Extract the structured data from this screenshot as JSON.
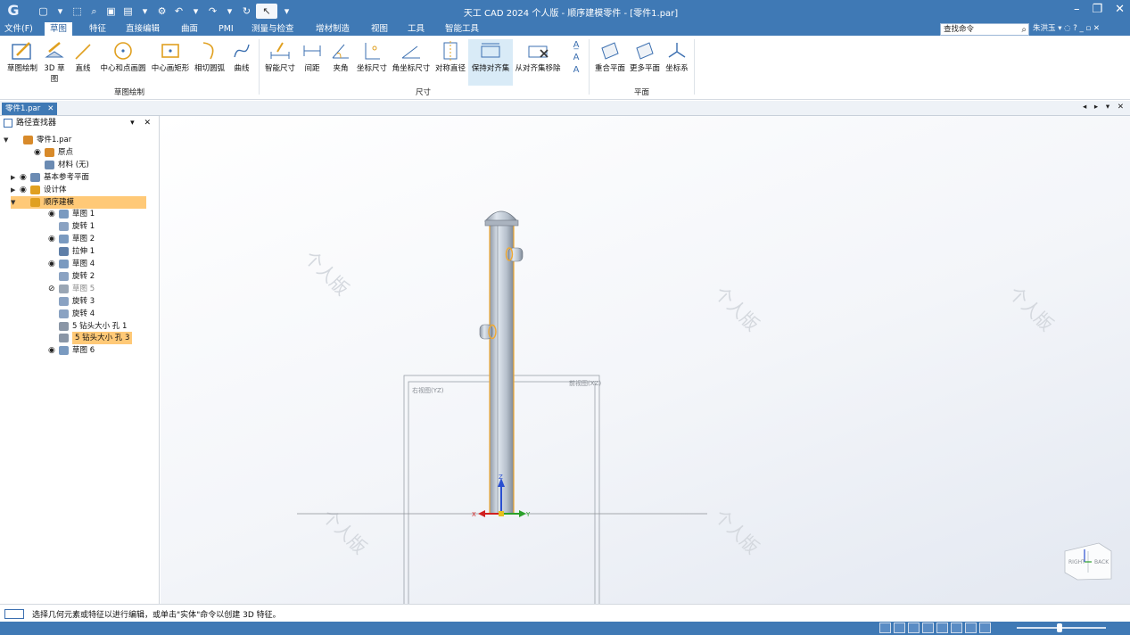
{
  "titlebar": {
    "title": "天工 CAD 2024 个人版 - 顺序建模零件 - [零件1.par]",
    "app_logo": "G",
    "qat_icons": [
      "new-file-icon",
      "open-file-icon",
      "save-icon",
      "save-as-icon",
      "settings-icon",
      "undo-icon",
      "redo-icon",
      "select-tool-icon"
    ],
    "controls": {
      "minimize": "–",
      "restore": "❐",
      "close": "✕"
    }
  },
  "menubar": {
    "items": [
      "文件(F)",
      "草图",
      "特征",
      "直接编辑",
      "曲面",
      "PMI",
      "测量与检查",
      "增材制造",
      "视图",
      "工具",
      "智能工具"
    ],
    "active_index": 1,
    "search_placeholder": "查找命令",
    "user": "朱洪玉",
    "help_icons": "▾ ◌ ?  _ ▫ ✕"
  },
  "ribbon": {
    "sketch_group": {
      "label": "草图绘制",
      "buttons": [
        "草图绘制",
        "3D 草图",
        "直线",
        "中心和点画圆",
        "中心画矩形",
        "相切圆弧",
        "曲线"
      ]
    },
    "dimension_group": {
      "label": "尺寸",
      "buttons": [
        "智能尺寸",
        "间距",
        "夹角",
        "坐标尺寸",
        "角坐标尺寸",
        "对称直径",
        "保持对齐集",
        "从对齐集移除"
      ]
    },
    "plane_group": {
      "label": "平面",
      "buttons": [
        "重合平面",
        "更多平面",
        "坐标系"
      ]
    }
  },
  "tabstrip": {
    "doc_tab": "零件1.par",
    "close": "✕",
    "nav": "◂ ▸ ▾ ✕"
  },
  "pathfinder": {
    "title": "路径查找器",
    "controls": "▾ ✕",
    "rows": [
      {
        "label": "零件1.par",
        "level": 0,
        "arrow": "▼",
        "eye": false
      },
      {
        "label": "原点",
        "level": 2,
        "arrow": "",
        "eye": true
      },
      {
        "label": "材料 (无)",
        "level": 2,
        "arrow": "",
        "eye": false
      },
      {
        "label": "基本参考平面",
        "level": 1,
        "arrow": "▶",
        "eye": true
      },
      {
        "label": "设计体",
        "level": 1,
        "arrow": "▶",
        "eye": true
      },
      {
        "label": "顺序建模",
        "level": 1,
        "arrow": "▼",
        "eye": false,
        "highlight": true
      },
      {
        "label": "草图 1",
        "level": 3,
        "arrow": "",
        "eye": true
      },
      {
        "label": "旋转 1",
        "level": 3,
        "arrow": "",
        "eye": false
      },
      {
        "label": "草图 2",
        "level": 3,
        "arrow": "",
        "eye": true
      },
      {
        "label": "拉伸 1",
        "level": 3,
        "arrow": "",
        "eye": false
      },
      {
        "label": "草图 4",
        "level": 3,
        "arrow": "",
        "eye": true
      },
      {
        "label": "旋转 2",
        "level": 3,
        "arrow": "",
        "eye": false
      },
      {
        "label": "草图 5",
        "level": 3,
        "arrow": "",
        "eye": "hidden",
        "dim": true
      },
      {
        "label": "旋转 3",
        "level": 3,
        "arrow": "",
        "eye": false
      },
      {
        "label": "旋转 4",
        "level": 3,
        "arrow": "",
        "eye": false
      },
      {
        "label": "5 钻头大小 孔 1",
        "level": 3,
        "arrow": "",
        "eye": false
      },
      {
        "label": "5 钻头大小 孔 3",
        "level": 3,
        "arrow": "",
        "eye": false,
        "selected": true
      },
      {
        "label": "草图 6",
        "level": 3,
        "arrow": "",
        "eye": true
      }
    ]
  },
  "viewport": {
    "watermark": "个人版",
    "plane_left_label": "右视图(YZ)",
    "plane_right_label": "前视图(XZ)",
    "axis_x": "X",
    "axis_y": "Y",
    "axis_z": "Z",
    "viewcube_right": "RIGHT",
    "viewcube_back": "BACK"
  },
  "status": {
    "text": "选择几何元素或特征以进行编辑，或单击\"实体\"命令以创建 3D 特征。"
  },
  "colors": {
    "accent": "#3f79b5",
    "selection": "#ffc977",
    "highlight_outline": "#f0a830"
  }
}
